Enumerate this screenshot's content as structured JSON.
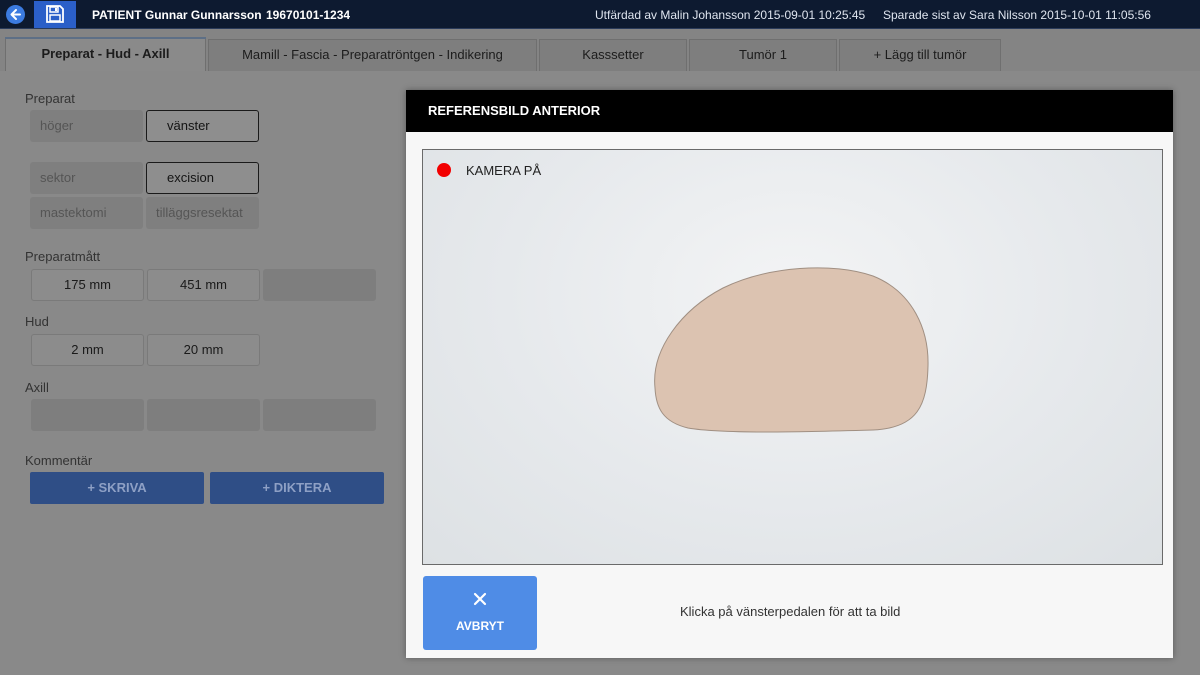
{
  "topbar": {
    "patient": "PATIENT Gunnar Gunnarsson",
    "personal_id": "19670101-1234",
    "issued": "Utfärdad av Malin Johansson 2015-09-01 10:25:45",
    "saved": "Sparade sist av Sara Nilsson 2015-10-01 11:05:56"
  },
  "tabs": [
    {
      "label": "Preparat - Hud - Axill",
      "active": true
    },
    {
      "label": "Mamill - Fascia - Preparatröntgen - Indikering",
      "active": false
    },
    {
      "label": "Kasssetter",
      "active": false
    },
    {
      "label": "Tumör 1",
      "active": false
    },
    {
      "label": "+ Lägg till tumör",
      "active": false
    }
  ],
  "form": {
    "preparat_label": "Preparat",
    "side_options": [
      "höger",
      "vänster"
    ],
    "type_options": [
      "sektor",
      "excision",
      "mastektomi",
      "tilläggsresektat"
    ],
    "preparatmatt_label": "Preparatmått",
    "preparatmatt_values": [
      "175 mm",
      "451 mm"
    ],
    "hud_label": "Hud",
    "hud_values": [
      "2 mm",
      "20 mm"
    ],
    "axill_label": "Axill",
    "kommentar_label": "Kommentär",
    "write_label": "+ SKRIVA",
    "dictate_label": "+ DIKTERA"
  },
  "modal": {
    "title": "REFERENSBILD ANTERIOR",
    "camera_label": "KAMERA PÅ",
    "cancel_label": "AVBRYT",
    "hint": "Klicka på vänsterpedalen för att ta bild"
  },
  "colors": {
    "topbar_bg": "#0d1a30",
    "accent": "#4f8ce6",
    "recording": "#f20000",
    "specimen": "#dcc3b1"
  },
  "icons": {
    "back": "arrow-left-icon",
    "save": "floppy-disk-icon",
    "record": "record-dot-icon",
    "cancel": "close-icon"
  }
}
